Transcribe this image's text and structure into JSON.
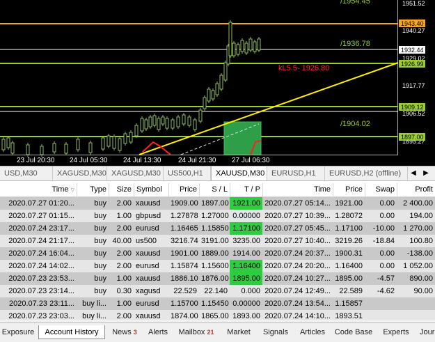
{
  "chart": {
    "price_axis_labels": [
      "1951.52",
      "1940.27",
      "1932.44",
      "1929.02",
      "1917.77",
      "1906.52",
      "1895.27"
    ],
    "highlight_labels": {
      "orange": "1943.40",
      "green_top": "1926.99",
      "green_mid": "1909.12",
      "green_low": "1897.00"
    },
    "line_labels": {
      "top_cut": "/1954.45",
      "mid": "/1936.78",
      "lower": "/1904.02",
      "red": "kL5.5- 1926.80"
    },
    "time_labels": [
      "23 Jul 20:30",
      "24 Jul 05:30",
      "24 Jul 13:30",
      "24 Jul 21:30",
      "27 Jul 06:30"
    ],
    "colors": {
      "background": "#000000",
      "orange_line": "#f5a623",
      "green_line": "#9acd32",
      "white_line": "#ffffff",
      "trend_line": "#ffee00",
      "candle": "#6b8e23",
      "red_label": "#ff2a2a"
    }
  },
  "symbol_tabs": {
    "items": [
      "USD,M30",
      "XAGUSD,M30",
      "XAGUSD,M30",
      "US500,H1",
      "XAUUSD,M30",
      "EURUSD,H1",
      "EURUSD,H2 (offline)"
    ],
    "active_index": 4,
    "prev_icon": "triangle-left",
    "next_icon": "triangle-right"
  },
  "history": {
    "columns": [
      "Time",
      "Type",
      "Size",
      "Symbol",
      "Price",
      "S / L",
      "T / P",
      "Time",
      "Price",
      "Swap",
      "Profit"
    ],
    "rows": [
      {
        "open_time": "2020.07.27 01:20...",
        "type": "buy",
        "size": "2.00",
        "symbol": "xauusd",
        "price": "1909.00",
        "sl": "1897.00",
        "tp": "1921.00",
        "tp_hit": true,
        "close_time": "2020.07.27 05:14...",
        "close_price": "1921.00",
        "swap": "0.00",
        "profit": "2 400.00"
      },
      {
        "open_time": "2020.07.27 01:15...",
        "type": "buy",
        "size": "1.00",
        "symbol": "gbpusd",
        "price": "1.27878",
        "sl": "1.27000",
        "tp": "0.00000",
        "tp_hit": false,
        "close_time": "2020.07.27 10:39...",
        "close_price": "1.28072",
        "swap": "0.00",
        "profit": "194.00"
      },
      {
        "open_time": "2020.07.24 23:17...",
        "type": "buy",
        "size": "2.00",
        "symbol": "eurusd",
        "price": "1.16465",
        "sl": "1.15850",
        "tp": "1.17100",
        "tp_hit": true,
        "close_time": "2020.07.27 05:45...",
        "close_price": "1.17100",
        "swap": "-10.00",
        "profit": "1 270.00"
      },
      {
        "open_time": "2020.07.24 21:17...",
        "type": "buy",
        "size": "40.00",
        "symbol": "us500",
        "price": "3216.74",
        "sl": "3191.00",
        "tp": "3235.00",
        "tp_hit": false,
        "close_time": "2020.07.27 10:40...",
        "close_price": "3219.26",
        "swap": "-18.84",
        "profit": "100.80"
      },
      {
        "open_time": "2020.07.24 16:04...",
        "type": "buy",
        "size": "2.00",
        "symbol": "xauusd",
        "price": "1901.00",
        "sl": "1889.00",
        "tp": "1914.00",
        "tp_hit": false,
        "close_time": "2020.07.24 20:37...",
        "close_price": "1900.31",
        "swap": "0.00",
        "profit": "-138.00"
      },
      {
        "open_time": "2020.07.24 14:02...",
        "type": "buy",
        "size": "2.00",
        "symbol": "eurusd",
        "price": "1.15874",
        "sl": "1.15600",
        "tp": "1.16400",
        "tp_hit": true,
        "close_time": "2020.07.24 20:20...",
        "close_price": "1.16400",
        "swap": "0.00",
        "profit": "1 052.00"
      },
      {
        "open_time": "2020.07.23 23:53...",
        "type": "buy",
        "size": "1.00",
        "symbol": "xauusd",
        "price": "1886.10",
        "sl": "1876.00",
        "tp": "1895.00",
        "tp_hit": true,
        "close_time": "2020.07.24 10:27...",
        "close_price": "1895.00",
        "swap": "-4.57",
        "profit": "890.00"
      },
      {
        "open_time": "2020.07.23 23:14...",
        "type": "buy",
        "size": "0.30",
        "symbol": "xagusd",
        "price": "22.529",
        "sl": "22.140",
        "tp": "0.000",
        "tp_hit": false,
        "close_time": "2020.07.24 12:49...",
        "close_price": "22.589",
        "swap": "-4.62",
        "profit": "90.00"
      },
      {
        "open_time": "2020.07.23 23:11...",
        "type": "buy li...",
        "size": "1.00",
        "symbol": "eurusd",
        "price": "1.15700",
        "sl": "1.15450",
        "tp": "0.00000",
        "tp_hit": false,
        "close_time": "2020.07.24 13:54...",
        "close_price": "1.15857",
        "swap": "",
        "profit": ""
      },
      {
        "open_time": "2020.07.23 23:03...",
        "type": "buy li...",
        "size": "2.00",
        "symbol": "xauusd",
        "price": "1874.00",
        "sl": "1865.00",
        "tp": "1893.00",
        "tp_hit": false,
        "close_time": "2020.07.24 14:10...",
        "close_price": "1893.51",
        "swap": "",
        "profit": ""
      }
    ]
  },
  "bottom_tabs": [
    {
      "label": "Exposure",
      "count": ""
    },
    {
      "label": "Account History",
      "count": "",
      "active": true
    },
    {
      "label": "News",
      "count": "3"
    },
    {
      "label": "Alerts",
      "count": ""
    },
    {
      "label": "Mailbox",
      "count": "21"
    },
    {
      "label": "Market",
      "count": ""
    },
    {
      "label": "Signals",
      "count": ""
    },
    {
      "label": "Articles",
      "count": ""
    },
    {
      "label": "Code Base",
      "count": ""
    },
    {
      "label": "Experts",
      "count": ""
    },
    {
      "label": "Jour",
      "count": ""
    }
  ]
}
